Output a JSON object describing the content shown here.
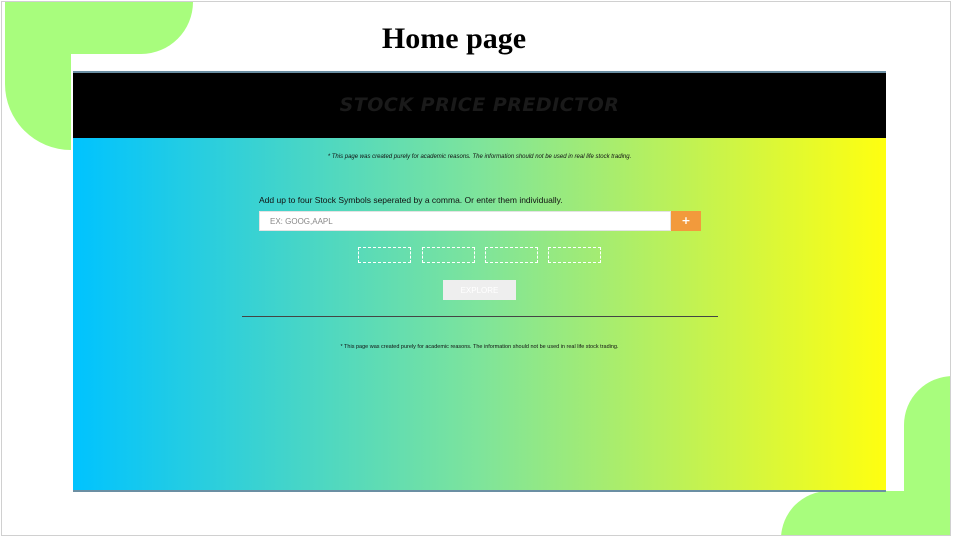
{
  "slide": {
    "title": "Home page"
  },
  "app": {
    "title": "STOCK PRICE PREDICTOR",
    "disclaimer_top": "* This page was created purely for academic reasons. The information should not be used in real life stock trading.",
    "instruction": "Add up to four Stock Symbols seperated by a comma. Or enter them individually.",
    "search": {
      "placeholder": "EX: GOOG,AAPL",
      "value": ""
    },
    "add_button_label": "+",
    "slots": [
      "",
      "",
      "",
      ""
    ],
    "explore_label": "EXPLORE",
    "disclaimer_bottom": "* This page was created purely for academic reasons. The information should not be used in real life stock trading."
  },
  "colors": {
    "accent_green": "#a8fd7d",
    "header_black": "#000000",
    "gradient_start": "#00c3ff",
    "gradient_end": "#ffff10",
    "add_button": "#f29a3c"
  },
  "icons": {
    "add": "plus-icon"
  }
}
